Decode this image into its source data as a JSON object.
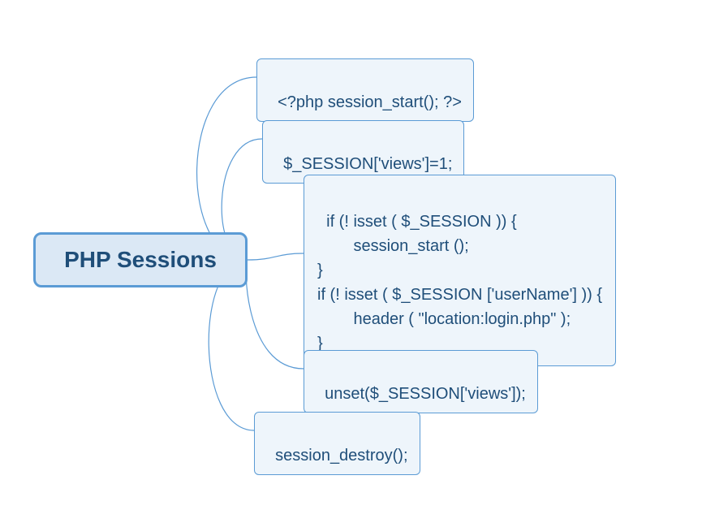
{
  "root": {
    "label": "PHP Sessions",
    "color_fill": "#dbe8f5",
    "color_border": "#5b9bd5",
    "color_text": "#1f4e79"
  },
  "children": [
    {
      "text": "<?php session_start(); ?>"
    },
    {
      "text": "$_SESSION['views']=1;"
    },
    {
      "text": "if (! isset ( $_SESSION )) {\n        session_start ();\n}\nif (! isset ( $_SESSION ['userName'] )) {\n        header ( \"location:login.php\" );\n}"
    },
    {
      "text": "unset($_SESSION['views']);"
    },
    {
      "text": "session_destroy();"
    }
  ]
}
